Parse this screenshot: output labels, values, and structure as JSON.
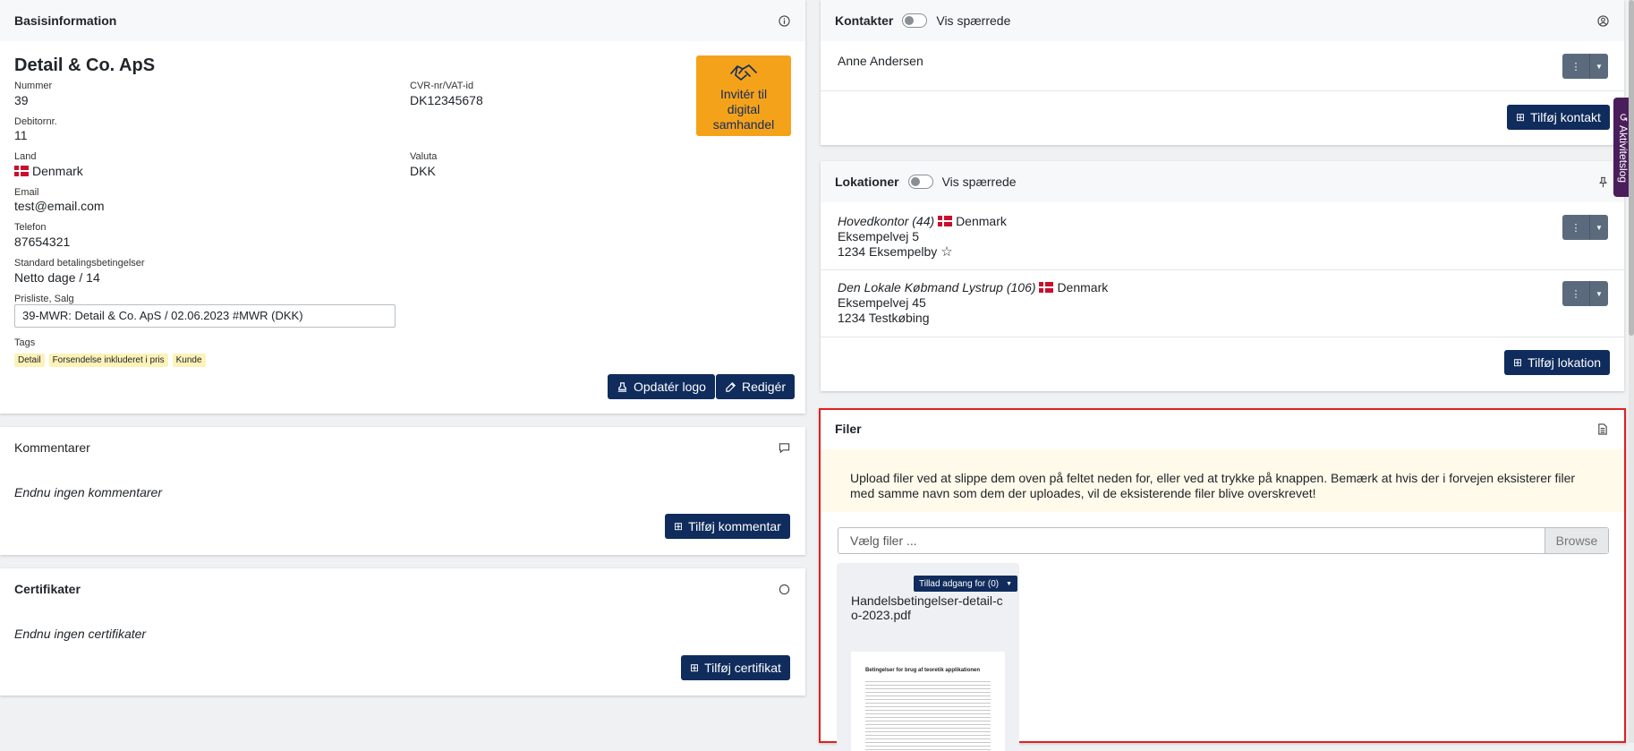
{
  "basis": {
    "title": "Basisinformation",
    "company": "Detail & Co. ApS",
    "nummer_label": "Nummer",
    "nummer": "39",
    "cvr_label": "CVR-nr/VAT-id",
    "cvr": "DK12345678",
    "debitor_label": "Debitornr.",
    "debitor": "11",
    "land_label": "Land",
    "land": "Denmark",
    "valuta_label": "Valuta",
    "valuta": "DKK",
    "email_label": "Email",
    "email": "test@email.com",
    "telefon_label": "Telefon",
    "telefon": "87654321",
    "betaling_label": "Standard betalingsbetingelser",
    "betaling": "Netto dage / 14",
    "prisliste_label": "Prisliste, Salg",
    "prisliste": "39-MWR: Detail & Co. ApS / 02.06.2023 #MWR (DKK)",
    "tags_label": "Tags",
    "tags": [
      "Detail",
      "Forsendelse inkluderet i pris",
      "Kunde"
    ],
    "invite_label": "Invitér til digital samhandel",
    "update_logo": "Opdatér logo",
    "edit": "Redigér"
  },
  "kommentarer": {
    "title": "Kommentarer",
    "empty": "Endnu ingen kommentarer",
    "add": "Tilføj kommentar"
  },
  "certifikater": {
    "title": "Certifikater",
    "empty": "Endnu ingen certifikater",
    "add": "Tilføj certifikat"
  },
  "kontakter": {
    "title": "Kontakter",
    "toggle": "Vis spærrede",
    "contact": "Anne Andersen",
    "add": "Tilføj kontakt"
  },
  "lokationer": {
    "title": "Lokationer",
    "toggle": "Vis spærrede",
    "items": [
      {
        "name": "Hovedkontor (44)",
        "country": "Denmark",
        "street": "Eksempelvej 5",
        "city": "1234 Eksempelby"
      },
      {
        "name": "Den Lokale Købmand Lystrup (106)",
        "country": "Denmark",
        "street": "Eksempelvej 45",
        "city": "1234 Testkøbing"
      }
    ],
    "add": "Tilføj lokation"
  },
  "filer": {
    "title": "Filer",
    "notice": "Upload filer ved at slippe dem oven på feltet neden for, eller ved at trykke på knappen. Bemærk at hvis der i forvejen eksisterer filer med samme navn som dem der uploades, vil de eksisterende filer blive overskrevet!",
    "placeholder": "Vælg filer ...",
    "browse": "Browse",
    "access": "Tillad adgang for (0)",
    "filename": "Handelsbetingelser-detail-co-2023.pdf",
    "preview_heading": "Betingelser for brug af teoretik applikationen"
  },
  "side_tab": "Aktivitetslog",
  "colors": {
    "primary": "#0f2c5c",
    "invite": "#f5a21b",
    "highlight": "#e02020",
    "tag": "#fdf2b8"
  }
}
